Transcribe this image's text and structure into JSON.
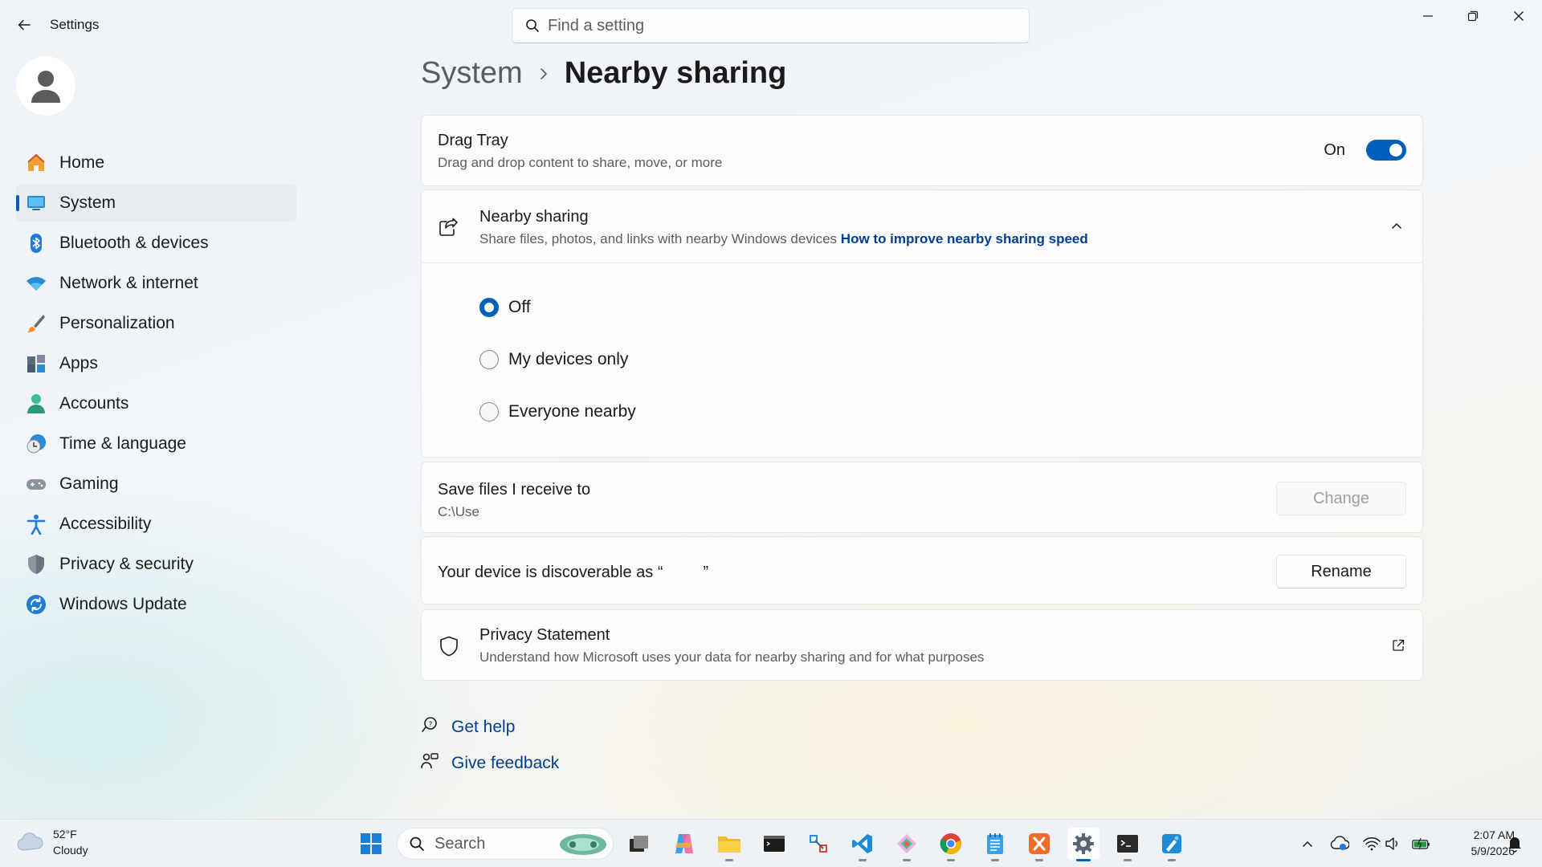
{
  "window": {
    "title": "Settings"
  },
  "search": {
    "placeholder": "Find a setting"
  },
  "sidebar": {
    "items": [
      {
        "label": "Home",
        "icon": "home-icon"
      },
      {
        "label": "System",
        "icon": "system-icon",
        "active": true
      },
      {
        "label": "Bluetooth & devices",
        "icon": "bluetooth-icon"
      },
      {
        "label": "Network & internet",
        "icon": "wifi-icon"
      },
      {
        "label": "Personalization",
        "icon": "brush-icon"
      },
      {
        "label": "Apps",
        "icon": "apps-icon"
      },
      {
        "label": "Accounts",
        "icon": "person-icon"
      },
      {
        "label": "Time & language",
        "icon": "clock-globe-icon"
      },
      {
        "label": "Gaming",
        "icon": "gamepad-icon"
      },
      {
        "label": "Accessibility",
        "icon": "accessibility-icon"
      },
      {
        "label": "Privacy & security",
        "icon": "shield-icon"
      },
      {
        "label": "Windows Update",
        "icon": "update-icon"
      }
    ]
  },
  "breadcrumb": {
    "parent": "System",
    "current": "Nearby sharing"
  },
  "drag_tray": {
    "title": "Drag Tray",
    "subtitle": "Drag and drop content to share, move, or more",
    "state_label": "On",
    "enabled": true
  },
  "nearby": {
    "title": "Nearby sharing",
    "subtitle": "Share files, photos, and links with nearby Windows devices",
    "link": "How to improve nearby sharing speed",
    "options": [
      {
        "label": "Off",
        "selected": true
      },
      {
        "label": "My devices only",
        "selected": false
      },
      {
        "label": "Everyone nearby",
        "selected": false
      }
    ]
  },
  "save_files": {
    "title": "Save files I receive to",
    "path": "C:\\Use",
    "button": "Change"
  },
  "discoverable": {
    "prefix": "Your device is discoverable as “",
    "name": "",
    "suffix": "”",
    "button": "Rename"
  },
  "privacy": {
    "title": "Privacy Statement",
    "subtitle": "Understand how Microsoft uses your data for nearby sharing and for what purposes"
  },
  "help": {
    "get_help": "Get help",
    "give_feedback": "Give feedback"
  },
  "taskbar": {
    "weather_temp": "52°F",
    "weather_desc": "Cloudy",
    "search_label": "Search",
    "time": "2:07 AM",
    "date": "5/9/2026"
  },
  "colors": {
    "accent": "#005fb8",
    "link": "#003e92"
  }
}
